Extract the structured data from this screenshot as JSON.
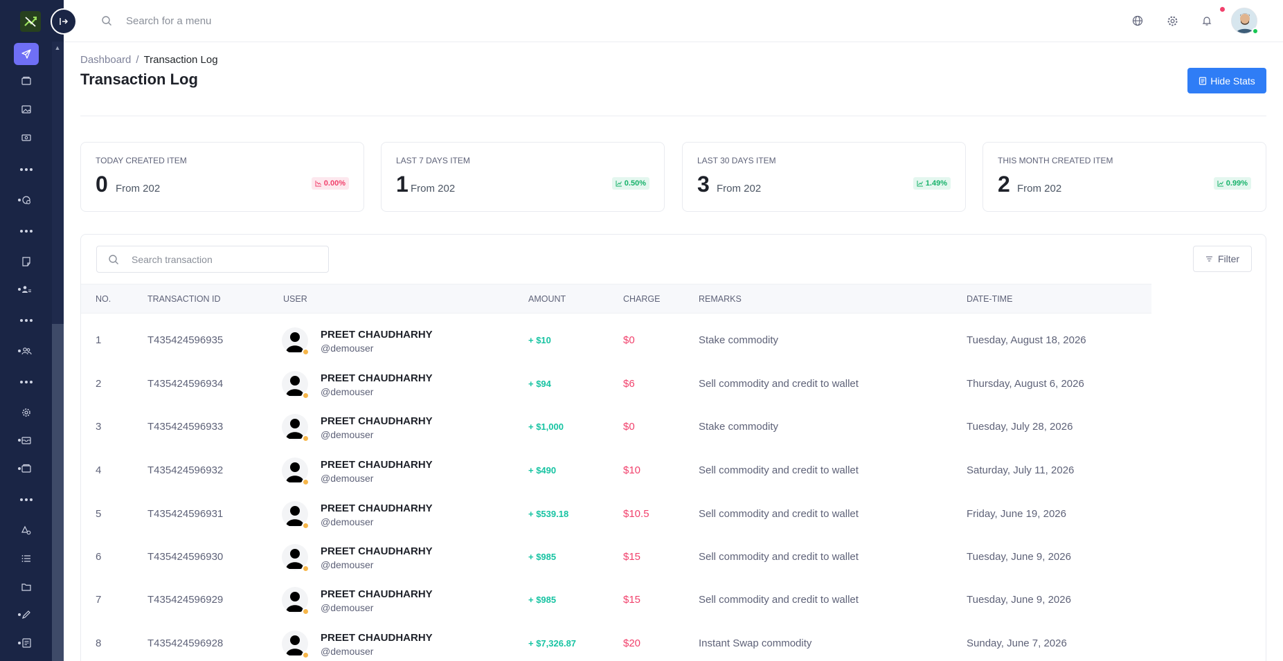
{
  "header": {
    "search_placeholder": "Search for a menu",
    "icons": [
      "globe-icon",
      "gear-icon",
      "bell-icon"
    ]
  },
  "sidebar": {
    "items": [
      "send-icon",
      "folder-icon",
      "image-icon",
      "cash-icon",
      "more",
      "support-icon",
      "more",
      "notes-icon",
      "users-icon",
      "more",
      "group-icon",
      "more",
      "gear-icon",
      "inbox-icon",
      "folder-icon",
      "more",
      "settings-icon",
      "list-icon",
      "folder-icon",
      "pen-icon",
      "form-icon"
    ]
  },
  "page": {
    "breadcrumb": {
      "root": "Dashboard",
      "separator": "/",
      "current": "Transaction Log"
    },
    "title": "Transaction Log",
    "hide_stats_label": "Hide Stats"
  },
  "stats": [
    {
      "label": "TODAY CREATED ITEM",
      "value": "0",
      "from": "From 202",
      "change": "0.00%",
      "trend": "down"
    },
    {
      "label": "LAST 7 DAYS ITEM",
      "value": "1",
      "from": "From 202",
      "change": "0.50%",
      "trend": "up"
    },
    {
      "label": "LAST 30 DAYS ITEM",
      "value": "3",
      "from": "From 202",
      "change": "1.49%",
      "trend": "up"
    },
    {
      "label": "THIS MONTH CREATED ITEM",
      "value": "2",
      "from": "From 202",
      "change": "0.99%",
      "trend": "up"
    }
  ],
  "table": {
    "search_placeholder": "Search transaction",
    "filter_label": "Filter",
    "columns": [
      "NO.",
      "TRANSACTION ID",
      "USER",
      "AMOUNT",
      "CHARGE",
      "REMARKS",
      "DATE-TIME"
    ],
    "rows": [
      {
        "no": "1",
        "tx_id": "T435424596935",
        "user": "PREET CHAUDHARHY",
        "handle": "@demouser",
        "amount": "+ $10",
        "charge": "$0",
        "remarks": "Stake commodity",
        "date": "Tuesday, August 18, 2026"
      },
      {
        "no": "2",
        "tx_id": "T435424596934",
        "user": "PREET CHAUDHARHY",
        "handle": "@demouser",
        "amount": "+ $94",
        "charge": "$6",
        "remarks": "Sell commodity and credit to wallet",
        "date": "Thursday, August 6, 2026"
      },
      {
        "no": "3",
        "tx_id": "T435424596933",
        "user": "PREET CHAUDHARHY",
        "handle": "@demouser",
        "amount": "+ $1,000",
        "charge": "$0",
        "remarks": "Stake commodity",
        "date": "Tuesday, July 28, 2026"
      },
      {
        "no": "4",
        "tx_id": "T435424596932",
        "user": "PREET CHAUDHARHY",
        "handle": "@demouser",
        "amount": "+ $490",
        "charge": "$10",
        "remarks": "Sell commodity and credit to wallet",
        "date": "Saturday, July 11, 2026"
      },
      {
        "no": "5",
        "tx_id": "T435424596931",
        "user": "PREET CHAUDHARHY",
        "handle": "@demouser",
        "amount": "+ $539.18",
        "charge": "$10.5",
        "remarks": "Sell commodity and credit to wallet",
        "date": "Friday, June 19, 2026"
      },
      {
        "no": "6",
        "tx_id": "T435424596930",
        "user": "PREET CHAUDHARHY",
        "handle": "@demouser",
        "amount": "+ $985",
        "charge": "$15",
        "remarks": "Sell commodity and credit to wallet",
        "date": "Tuesday, June 9, 2026"
      },
      {
        "no": "7",
        "tx_id": "T435424596929",
        "user": "PREET CHAUDHARHY",
        "handle": "@demouser",
        "amount": "+ $985",
        "charge": "$15",
        "remarks": "Sell commodity and credit to wallet",
        "date": "Tuesday, June 9, 2026"
      },
      {
        "no": "8",
        "tx_id": "T435424596928",
        "user": "PREET CHAUDHARHY",
        "handle": "@demouser",
        "amount": "+ $7,326.87",
        "charge": "$20",
        "remarks": "Instant Swap commodity",
        "date": "Sunday, June 7, 2026"
      }
    ]
  },
  "colors": {
    "sidebar": "#1a2545",
    "accent": "#6f6ff5",
    "primary_button": "#2f7df6",
    "positive": "#17c3a2",
    "negative": "#f1416c"
  }
}
